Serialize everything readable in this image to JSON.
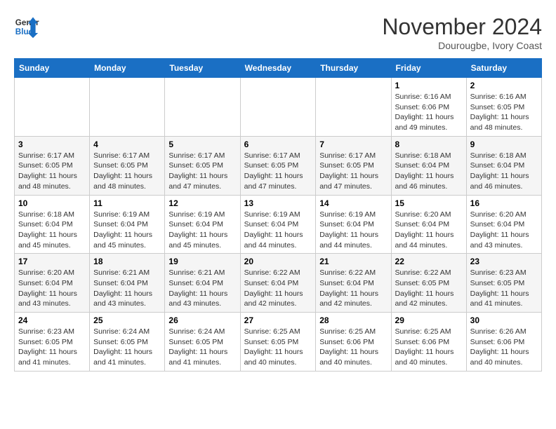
{
  "logo": {
    "line1": "General",
    "line2": "Blue"
  },
  "title": "November 2024",
  "location": "Dourougbe, Ivory Coast",
  "weekdays": [
    "Sunday",
    "Monday",
    "Tuesday",
    "Wednesday",
    "Thursday",
    "Friday",
    "Saturday"
  ],
  "weeks": [
    [
      {
        "day": "",
        "info": ""
      },
      {
        "day": "",
        "info": ""
      },
      {
        "day": "",
        "info": ""
      },
      {
        "day": "",
        "info": ""
      },
      {
        "day": "",
        "info": ""
      },
      {
        "day": "1",
        "info": "Sunrise: 6:16 AM\nSunset: 6:06 PM\nDaylight: 11 hours and 49 minutes."
      },
      {
        "day": "2",
        "info": "Sunrise: 6:16 AM\nSunset: 6:05 PM\nDaylight: 11 hours and 48 minutes."
      }
    ],
    [
      {
        "day": "3",
        "info": "Sunrise: 6:17 AM\nSunset: 6:05 PM\nDaylight: 11 hours and 48 minutes."
      },
      {
        "day": "4",
        "info": "Sunrise: 6:17 AM\nSunset: 6:05 PM\nDaylight: 11 hours and 48 minutes."
      },
      {
        "day": "5",
        "info": "Sunrise: 6:17 AM\nSunset: 6:05 PM\nDaylight: 11 hours and 47 minutes."
      },
      {
        "day": "6",
        "info": "Sunrise: 6:17 AM\nSunset: 6:05 PM\nDaylight: 11 hours and 47 minutes."
      },
      {
        "day": "7",
        "info": "Sunrise: 6:17 AM\nSunset: 6:05 PM\nDaylight: 11 hours and 47 minutes."
      },
      {
        "day": "8",
        "info": "Sunrise: 6:18 AM\nSunset: 6:04 PM\nDaylight: 11 hours and 46 minutes."
      },
      {
        "day": "9",
        "info": "Sunrise: 6:18 AM\nSunset: 6:04 PM\nDaylight: 11 hours and 46 minutes."
      }
    ],
    [
      {
        "day": "10",
        "info": "Sunrise: 6:18 AM\nSunset: 6:04 PM\nDaylight: 11 hours and 45 minutes."
      },
      {
        "day": "11",
        "info": "Sunrise: 6:19 AM\nSunset: 6:04 PM\nDaylight: 11 hours and 45 minutes."
      },
      {
        "day": "12",
        "info": "Sunrise: 6:19 AM\nSunset: 6:04 PM\nDaylight: 11 hours and 45 minutes."
      },
      {
        "day": "13",
        "info": "Sunrise: 6:19 AM\nSunset: 6:04 PM\nDaylight: 11 hours and 44 minutes."
      },
      {
        "day": "14",
        "info": "Sunrise: 6:19 AM\nSunset: 6:04 PM\nDaylight: 11 hours and 44 minutes."
      },
      {
        "day": "15",
        "info": "Sunrise: 6:20 AM\nSunset: 6:04 PM\nDaylight: 11 hours and 44 minutes."
      },
      {
        "day": "16",
        "info": "Sunrise: 6:20 AM\nSunset: 6:04 PM\nDaylight: 11 hours and 43 minutes."
      }
    ],
    [
      {
        "day": "17",
        "info": "Sunrise: 6:20 AM\nSunset: 6:04 PM\nDaylight: 11 hours and 43 minutes."
      },
      {
        "day": "18",
        "info": "Sunrise: 6:21 AM\nSunset: 6:04 PM\nDaylight: 11 hours and 43 minutes."
      },
      {
        "day": "19",
        "info": "Sunrise: 6:21 AM\nSunset: 6:04 PM\nDaylight: 11 hours and 43 minutes."
      },
      {
        "day": "20",
        "info": "Sunrise: 6:22 AM\nSunset: 6:04 PM\nDaylight: 11 hours and 42 minutes."
      },
      {
        "day": "21",
        "info": "Sunrise: 6:22 AM\nSunset: 6:04 PM\nDaylight: 11 hours and 42 minutes."
      },
      {
        "day": "22",
        "info": "Sunrise: 6:22 AM\nSunset: 6:05 PM\nDaylight: 11 hours and 42 minutes."
      },
      {
        "day": "23",
        "info": "Sunrise: 6:23 AM\nSunset: 6:05 PM\nDaylight: 11 hours and 41 minutes."
      }
    ],
    [
      {
        "day": "24",
        "info": "Sunrise: 6:23 AM\nSunset: 6:05 PM\nDaylight: 11 hours and 41 minutes."
      },
      {
        "day": "25",
        "info": "Sunrise: 6:24 AM\nSunset: 6:05 PM\nDaylight: 11 hours and 41 minutes."
      },
      {
        "day": "26",
        "info": "Sunrise: 6:24 AM\nSunset: 6:05 PM\nDaylight: 11 hours and 41 minutes."
      },
      {
        "day": "27",
        "info": "Sunrise: 6:25 AM\nSunset: 6:05 PM\nDaylight: 11 hours and 40 minutes."
      },
      {
        "day": "28",
        "info": "Sunrise: 6:25 AM\nSunset: 6:06 PM\nDaylight: 11 hours and 40 minutes."
      },
      {
        "day": "29",
        "info": "Sunrise: 6:25 AM\nSunset: 6:06 PM\nDaylight: 11 hours and 40 minutes."
      },
      {
        "day": "30",
        "info": "Sunrise: 6:26 AM\nSunset: 6:06 PM\nDaylight: 11 hours and 40 minutes."
      }
    ]
  ]
}
